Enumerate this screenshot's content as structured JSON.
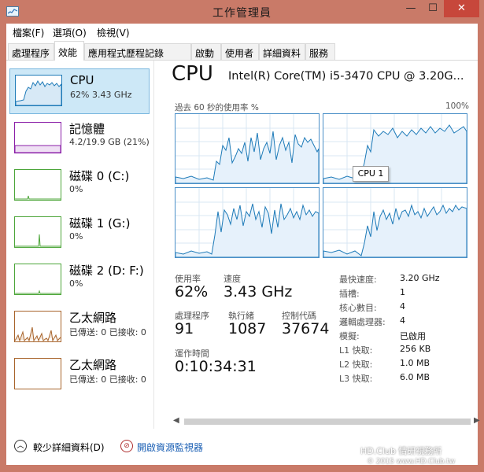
{
  "window": {
    "title": "工作管理員",
    "controls": {
      "minimize": "—",
      "maximize": "☐",
      "close": "✕"
    }
  },
  "menu": [
    "檔案(F)",
    "選項(O)",
    "檢視(V)"
  ],
  "tabs": [
    {
      "label": "處理程序",
      "active": false
    },
    {
      "label": "效能",
      "active": true
    },
    {
      "label": "應用程式歷程記錄",
      "active": false
    },
    {
      "label": "啟動",
      "active": false
    },
    {
      "label": "使用者",
      "active": false
    },
    {
      "label": "詳細資料",
      "active": false
    },
    {
      "label": "服務",
      "active": false
    }
  ],
  "sidebar": {
    "items": [
      {
        "title": "CPU",
        "sub": "62%  3.43 GHz",
        "color": "#1d7ab8",
        "selected": true
      },
      {
        "title": "記憶體",
        "sub": "4.2/19.9 GB (21%)",
        "color": "#8b1fa8",
        "selected": false
      },
      {
        "title": "磁碟 0 (C:)",
        "sub": "0%",
        "color": "#4da63a",
        "selected": false
      },
      {
        "title": "磁碟 1 (G:)",
        "sub": "0%",
        "color": "#4da63a",
        "selected": false
      },
      {
        "title": "磁碟 2 (D: F:)",
        "sub": "0%",
        "color": "#4da63a",
        "selected": false
      },
      {
        "title": "乙太網路",
        "sub": "已傳送: 0  已接收: 0",
        "color": "#a8642b",
        "selected": false
      },
      {
        "title": "乙太網路",
        "sub": "已傳送: 0  已接收: 0",
        "color": "#a8642b",
        "selected": false
      }
    ]
  },
  "main": {
    "heading": "CPU",
    "model": "Intel(R) Core(TM) i5-3470 CPU @ 3.20G...",
    "graph_caption": "過去 60 秒的使用率 %",
    "graph_max": "100%",
    "tooltip": "CPU 1",
    "stats": {
      "usage_label": "使用率",
      "usage": "62%",
      "speed_label": "速度",
      "speed": "3.43 GHz",
      "processes_label": "處理程序",
      "processes": "91",
      "threads_label": "執行緒",
      "threads": "1087",
      "handles_label": "控制代碼",
      "handles": "37674",
      "uptime_label": "運作時間",
      "uptime": "0:10:34:31"
    },
    "specs": [
      {
        "label": "最快速度:",
        "value": "3.20 GHz"
      },
      {
        "label": "插槽:",
        "value": "1"
      },
      {
        "label": "核心數目:",
        "value": "4"
      },
      {
        "label": "邏輯處理器:",
        "value": "4"
      },
      {
        "label": "模擬:",
        "value": "已啟用"
      },
      {
        "label": "L1 快取:",
        "value": "256 KB"
      },
      {
        "label": "L2 快取:",
        "value": "1.0 MB"
      },
      {
        "label": "L3 快取:",
        "value": "6.0 MB"
      }
    ]
  },
  "footer": {
    "fewer_details": "較少詳細資料(D)",
    "open_monitor": "開啟資源監視器"
  },
  "watermark": {
    "line1": "HD.Club 情研視務所",
    "line2": "© 2015 www.HD.Club.tw"
  },
  "icons": [
    "app-icon",
    "collapse-icon",
    "resource-monitor-icon"
  ],
  "colors": {
    "accent": "#4a8fc7",
    "graph_fill": "#e6f1fb",
    "title_bar": "#c97a68",
    "close": "#c7473b"
  }
}
